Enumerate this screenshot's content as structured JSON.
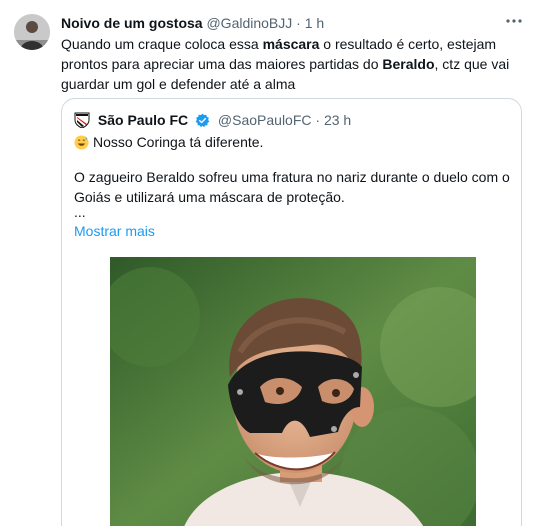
{
  "tweet": {
    "author_name": "Noivo de um gostosa",
    "author_handle": "@GaldinoBJJ",
    "separator": "·",
    "time": "1 h",
    "text": {
      "part1": "Quando um craque coloca essa ",
      "bold1": "máscara",
      "part2": " o resultado é certo, estejam prontos para apreciar uma das maiores partidas do ",
      "bold2": "Beraldo",
      "part3": ", ctz que vai guardar um gol e defender até a alma"
    }
  },
  "quote": {
    "author_name": "São Paulo FC",
    "author_handle": "@SaoPauloFC",
    "separator": "·",
    "time": "23 h",
    "line1": "Nosso Coringa tá diferente.",
    "line2": "O zagueiro Beraldo sofreu uma fratura no nariz durante o duelo com o Goiás e utilizará uma máscara de proteção.",
    "ellipsis": "...",
    "show_more": "Mostrar mais"
  },
  "icons": {
    "more": "more-icon",
    "verified": "verified-badge-icon",
    "club": "sao-paulo-crest-icon",
    "emoji": "grinning-sweat-emoji"
  },
  "colors": {
    "link": "#1d9bf0",
    "secondary_text": "#536471",
    "border": "#cfd9de"
  }
}
